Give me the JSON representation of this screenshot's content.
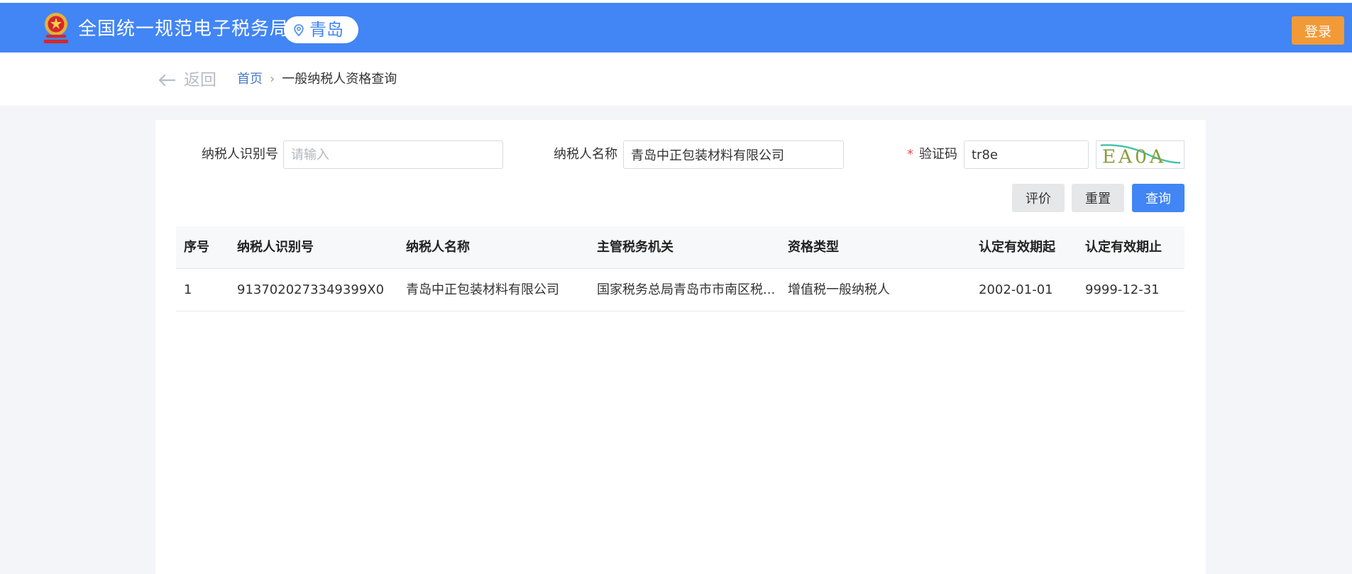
{
  "header": {
    "site_title": "全国统一规范电子税务局",
    "city": "青岛",
    "login_label": "登录",
    "accent_color": "#4285f4",
    "login_color": "#f29a37"
  },
  "nav": {
    "back_label": "返回",
    "breadcrumb": {
      "home": "首页",
      "separator": "›",
      "current": "一般纳税人资格查询"
    }
  },
  "form": {
    "taxpayer_id": {
      "label": "纳税人识别号",
      "value": "",
      "placeholder": "请输入"
    },
    "taxpayer_name": {
      "label": "纳税人名称",
      "value": "青岛中正包装材料有限公司"
    },
    "captcha": {
      "required_mark": "*",
      "label": "验证码",
      "value": "tr8e",
      "image_text": "EA0A"
    },
    "buttons": {
      "evaluate": "评价",
      "reset": "重置",
      "query": "查询"
    }
  },
  "table": {
    "columns": [
      "序号",
      "纳税人识别号",
      "纳税人名称",
      "主管税务机关",
      "资格类型",
      "认定有效期起",
      "认定有效期止"
    ],
    "rows": [
      [
        "1",
        "9137020273349399X0",
        "青岛中正包装材料有限公司",
        "国家税务总局青岛市市南区税...",
        "增值税一般纳税人",
        "2002-01-01",
        "9999-12-31"
      ]
    ]
  }
}
